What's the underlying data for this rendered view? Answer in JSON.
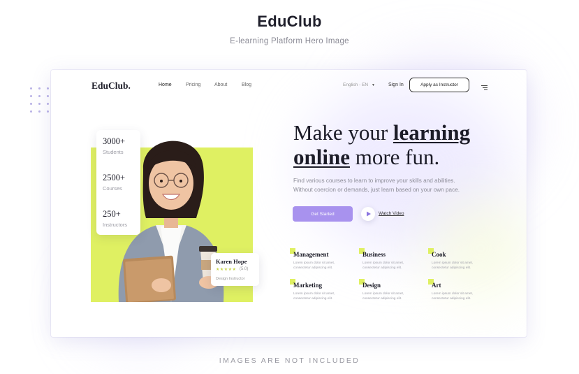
{
  "poster": {
    "title": "EduClub",
    "subtitle": "E-learning Platform Hero Image",
    "footer": "IMAGES ARE NOT INCLUDED"
  },
  "site": {
    "logo": "EduClub.",
    "nav": [
      "Home",
      "Pricing",
      "About",
      "Blog"
    ],
    "language": "English - EN",
    "sign_in": "Sign In",
    "apply_button": "Apply as Instructor"
  },
  "hero": {
    "headline": {
      "line1_plain": "Make your ",
      "line1_em": "learning",
      "line2_em": "online",
      "line2_plain": " more fun."
    },
    "description": [
      "Find various courses to learn to improve your skills and abilities.",
      "Without coercion or demands, just learn based on your own pace."
    ],
    "cta_primary": "Get Started",
    "cta_secondary": "Watch Video",
    "accent_color": "#a892ee",
    "highlight_color": "#dff062"
  },
  "stats": [
    {
      "value": "3000+",
      "label": "Students"
    },
    {
      "value": "2500+",
      "label": "Courses"
    },
    {
      "value": "250+",
      "label": "Instructors"
    }
  ],
  "instructor": {
    "name": "Karen Hope",
    "stars": "★★★★★",
    "rating": "(5.0)",
    "role": "Design Instructor"
  },
  "categories": [
    {
      "title": "Management",
      "desc": [
        "Lorem ipsum dolor sit amet,",
        "consectetur adipiscing elit."
      ]
    },
    {
      "title": "Business",
      "desc": [
        "Lorem ipsum dolor sit amet,",
        "consectetur adipiscing elit."
      ]
    },
    {
      "title": "Cook",
      "desc": [
        "Lorem ipsum dolor sit amet,",
        "consectetur adipiscing elit."
      ]
    },
    {
      "title": "Marketing",
      "desc": [
        "Lorem ipsum dolor sit amet,",
        "consectetur adipiscing elit."
      ]
    },
    {
      "title": "Design",
      "desc": [
        "Lorem ipsum dolor sit amet,",
        "consectetur adipiscing elit."
      ]
    },
    {
      "title": "Art",
      "desc": [
        "Lorem ipsum dolor sit amet,",
        "consectetur adipiscing elit."
      ]
    }
  ],
  "icons": {
    "menu": "menu-icon",
    "play": "play-icon",
    "chevron": "chevron-down-icon"
  }
}
